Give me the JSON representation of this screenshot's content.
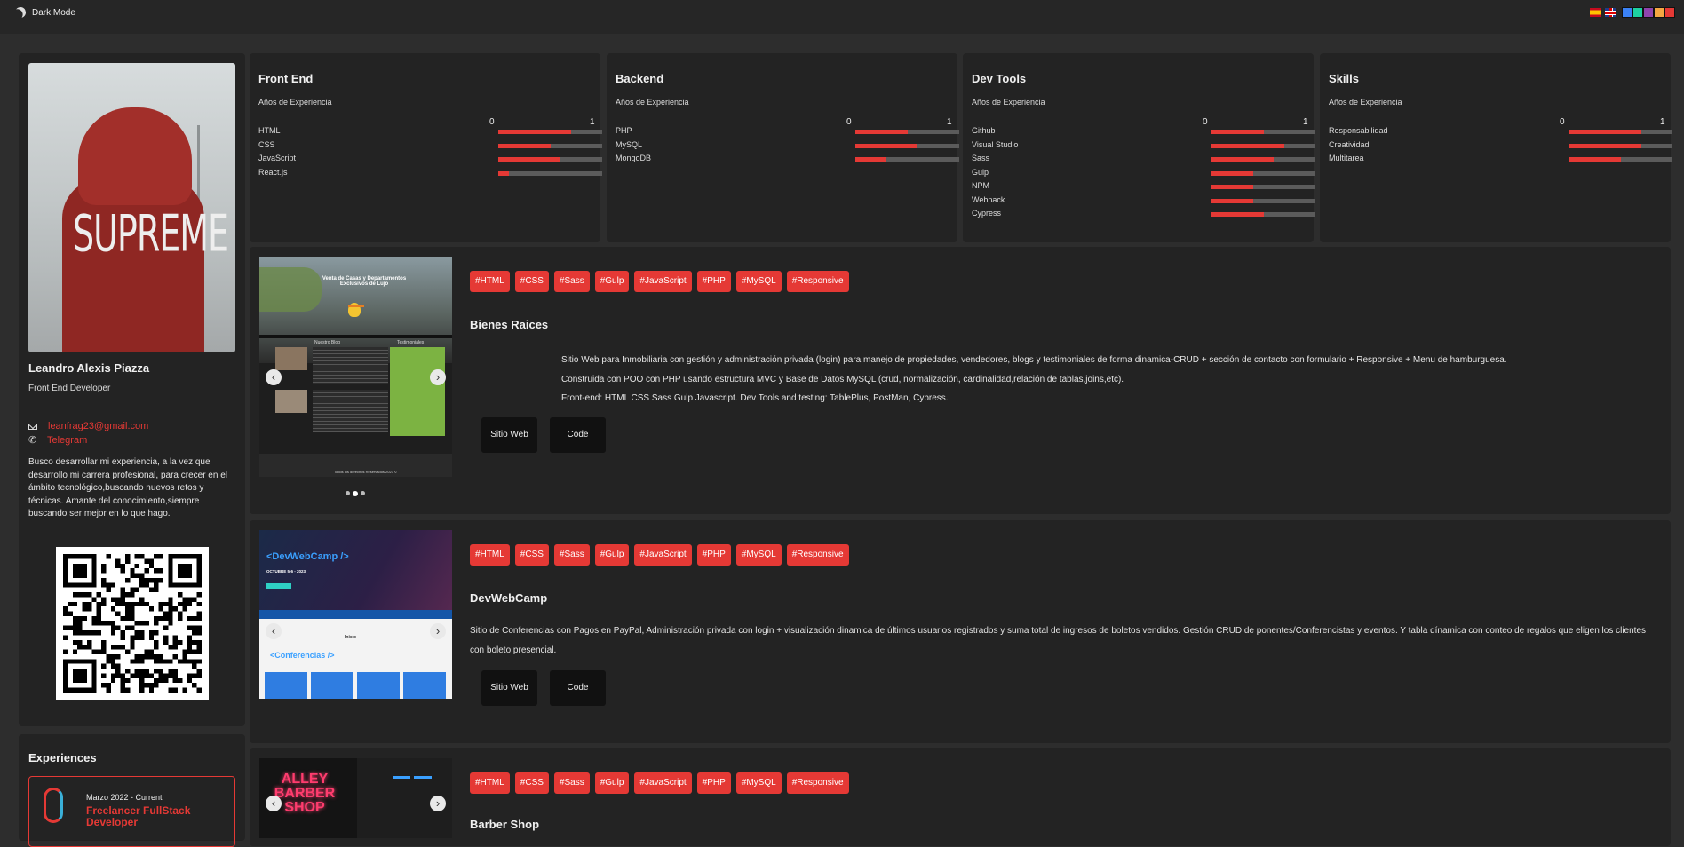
{
  "topbar": {
    "dark_mode_label": "Dark Mode",
    "languages": [
      "es-flag-icon",
      "uk-flag-icon"
    ],
    "theme_colors": [
      "#3b82f6",
      "#1dd1a1",
      "#8e44ad",
      "#f4a742",
      "#e53935"
    ]
  },
  "profile": {
    "name": "Leandro Alexis Piazza",
    "role": "Front End Developer",
    "photo_text": "SUPREME",
    "email": "leanfrag23@gmail.com",
    "telegram": "Telegram",
    "bio": "Busco desarrollar mi experiencia, a la vez que desarrollo mi carrera profesional, para crecer en el ámbito tecnológico,buscando nuevos retos y técnicas. Amante del conocimiento,siempre buscando ser mejor en lo que hago."
  },
  "experiences": {
    "title": "Experiences",
    "items": [
      {
        "date": "Marzo 2022 - Current",
        "role": "Freelancer FullStack Developer"
      }
    ]
  },
  "skills": [
    {
      "title": "Front End",
      "subtitle": "Años de Experiencia",
      "scale_min": "0",
      "scale_max": "1",
      "items": [
        {
          "label": "HTML",
          "value": 0.7
        },
        {
          "label": "CSS",
          "value": 0.5
        },
        {
          "label": "JavaScript",
          "value": 0.6
        },
        {
          "label": "React.js",
          "value": 0.1
        }
      ]
    },
    {
      "title": "Backend",
      "subtitle": "Años de Experiencia",
      "scale_min": "0",
      "scale_max": "1",
      "items": [
        {
          "label": "PHP",
          "value": 0.5
        },
        {
          "label": "MySQL",
          "value": 0.6
        },
        {
          "label": "MongoDB",
          "value": 0.3
        }
      ]
    },
    {
      "title": "Dev Tools",
      "subtitle": "Años de Experiencia",
      "scale_min": "0",
      "scale_max": "1",
      "items": [
        {
          "label": "Github",
          "value": 0.5
        },
        {
          "label": "Visual Studio",
          "value": 0.7
        },
        {
          "label": "Sass",
          "value": 0.6
        },
        {
          "label": "Gulp",
          "value": 0.4
        },
        {
          "label": "NPM",
          "value": 0.4
        },
        {
          "label": "Webpack",
          "value": 0.4
        },
        {
          "label": "Cypress",
          "value": 0.5
        }
      ]
    },
    {
      "title": "Skills",
      "subtitle": "Años de Experiencia",
      "scale_min": "0",
      "scale_max": "1",
      "items": [
        {
          "label": "Responsabilidad",
          "value": 0.7
        },
        {
          "label": "Creatividad",
          "value": 0.7
        },
        {
          "label": "Multitarea",
          "value": 0.5
        }
      ]
    }
  ],
  "projects": [
    {
      "title": "Bienes Raices",
      "tags": [
        "#HTML",
        "#CSS",
        "#Sass",
        "#Gulp",
        "#JavaScript",
        "#PHP",
        "#MySQL",
        "#Responsive"
      ],
      "description": [
        "Sitio Web para Inmobiliaria con gestión y administración privada (login) para manejo de propiedades, vendedores, blogs y testimoniales de forma dinamica-CRUD + sección de contacto con formulario + Responsive + Menu de hamburguesa.",
        "Construida con POO con PHP usando estructura MVC y Base de Datos MySQL (crud, normalización, cardinalidad,relación de tablas,joins,etc).",
        "Front-end: HTML CSS Sass Gulp Javascript. Dev Tools and testing: TablePlus, PostMan, Cypress."
      ],
      "site_label": "Sitio Web",
      "code_label": "Code",
      "shot": {
        "hero": "Venta de Casas y Departamentos Exclusivos de Lujo",
        "blog": "Nuestro Blog",
        "testimonials": "Testimoniales",
        "footer": "Todos los derechos Reservados 2023 ©"
      }
    },
    {
      "title": "DevWebCamp",
      "tags": [
        "#HTML",
        "#CSS",
        "#Sass",
        "#Gulp",
        "#JavaScript",
        "#PHP",
        "#MySQL",
        "#Responsive"
      ],
      "description": [
        "Sitio de Conferencias con Pagos en PayPal, Administración privada con login + visualización dinamica de últimos usuarios registrados y suma total de ingresos de boletos vendidos. Gestión CRUD de ponentes/Conferencistas y eventos. Y tabla dínamica con conteo de regalos que eligen los clientes con boleto presencial."
      ],
      "site_label": "Sitio Web",
      "code_label": "Code",
      "shot": {
        "logo": "<DevWebCamp />",
        "date": "OCTUBRE 5-6 - 2023",
        "section": "<Conferencias />",
        "sub": "Inicio"
      }
    },
    {
      "title": "Barber Shop",
      "tags": [
        "#HTML",
        "#CSS",
        "#Sass",
        "#Gulp",
        "#JavaScript",
        "#PHP",
        "#MySQL",
        "#Responsive"
      ],
      "shot": {
        "sign": "ALLEY BARBER SHOP"
      }
    }
  ]
}
